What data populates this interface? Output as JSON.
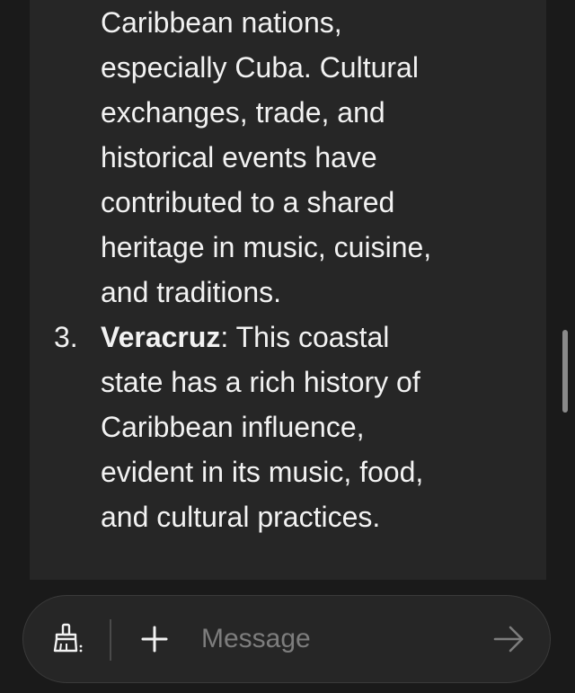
{
  "message": {
    "para_lines": [
      "Caribbean nations,",
      "especially Cuba. Cultural",
      "exchanges, trade, and",
      "historical events have",
      "contributed to a shared",
      "heritage in music, cuisine,",
      "and traditions."
    ],
    "item3": {
      "number": "3.",
      "title": "Veracruz",
      "first_line_rest": ": This coastal",
      "lines": [
        "state has a rich history of",
        "Caribbean influence,",
        "evident in its music, food,",
        "and cultural practices."
      ]
    }
  },
  "composer": {
    "placeholder": "Message",
    "icons": {
      "clear": "broom-icon",
      "add": "plus-icon",
      "send": "arrow-right-icon"
    }
  },
  "colors": {
    "background": "#1a1a1a",
    "panel": "#262626",
    "text": "#f2f2f2",
    "placeholder": "#7d7d7d"
  }
}
